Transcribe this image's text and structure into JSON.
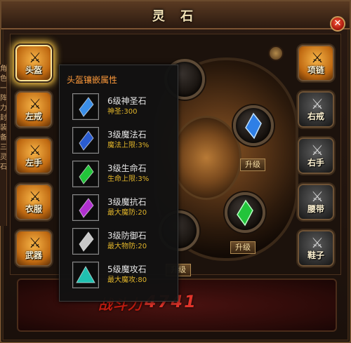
{
  "window": {
    "title": "灵 石",
    "close_label": "✕"
  },
  "left_tabs": [
    "角",
    "色",
    "一",
    "阵",
    "力",
    "封",
    "装",
    "备",
    "三",
    "灵",
    "石"
  ],
  "equipment_left": [
    {
      "id": "helmet",
      "label": "头盔",
      "glyph": "⚔",
      "style": "gold",
      "active": true
    },
    {
      "id": "left-ring",
      "label": "左戒",
      "glyph": "⚔",
      "style": "gold"
    },
    {
      "id": "left-hand",
      "label": "左手",
      "glyph": "⚔",
      "style": "gold"
    },
    {
      "id": "clothes",
      "label": "衣服",
      "glyph": "⚔",
      "style": "gold"
    },
    {
      "id": "weapon",
      "label": "武器",
      "glyph": "⚔",
      "style": "gold"
    }
  ],
  "equipment_right": [
    {
      "id": "necklace",
      "label": "项链",
      "glyph": "⚔",
      "style": "gold"
    },
    {
      "id": "right-ring",
      "label": "右戒",
      "glyph": "⚔",
      "style": "grey"
    },
    {
      "id": "right-hand",
      "label": "右手",
      "glyph": "⚔",
      "style": "grey"
    },
    {
      "id": "belt",
      "label": "腰带",
      "glyph": "⚔",
      "style": "grey"
    },
    {
      "id": "shoes",
      "label": "鞋子",
      "glyph": "⚔",
      "style": "grey"
    }
  ],
  "upgrade_label": "升级",
  "tooltip": {
    "title": "头盔镶嵌属性",
    "gems": [
      {
        "name": "6级神圣石",
        "attr": "神圣:300",
        "color": "#3a8ee8",
        "icon": "crystal-blue"
      },
      {
        "name": "3级魔法石",
        "attr": "魔法上限:3%",
        "color": "#2a5cd0",
        "icon": "crystal-blue"
      },
      {
        "name": "3级生命石",
        "attr": "生命上限:3%",
        "color": "#22c43a",
        "icon": "crystal-green"
      },
      {
        "name": "3级魔抗石",
        "attr": "最大魔防:20",
        "color": "#b030d0",
        "icon": "crystal-purple"
      },
      {
        "name": "3级防御石",
        "attr": "最大物防:20",
        "color": "#c8c8c8",
        "icon": "crystal-silver"
      },
      {
        "name": "5级魔攻石",
        "attr": "最大魔攻:80",
        "color": "#20c0b0",
        "icon": "triangle-teal"
      }
    ]
  },
  "power": {
    "label": "战斗力",
    "value": "4741"
  }
}
